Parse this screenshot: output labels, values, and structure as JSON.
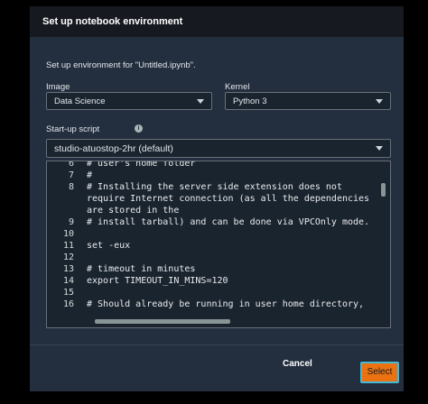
{
  "dialog": {
    "title": "Set up notebook environment",
    "subtitle": "Set up environment for \"Untitled.ipynb\".",
    "image": {
      "label": "Image",
      "value": "Data Science"
    },
    "kernel": {
      "label": "Kernel",
      "value": "Python 3"
    },
    "startup": {
      "label": "Start-up script",
      "value": "studio-atuostop-2hr (default)"
    },
    "code_lines": [
      {
        "n": "6",
        "text": "# user's home folder"
      },
      {
        "n": "7",
        "text": "#"
      },
      {
        "n": "8",
        "text": "# Installing the server side extension does not"
      },
      {
        "n": "",
        "text": "require Internet connection (as all the dependencies"
      },
      {
        "n": "",
        "text": "are stored in the"
      },
      {
        "n": "9",
        "text": "# install tarball) and can be done via VPCOnly mode."
      },
      {
        "n": "10",
        "text": ""
      },
      {
        "n": "11",
        "text": "set -eux"
      },
      {
        "n": "12",
        "text": ""
      },
      {
        "n": "13",
        "text": "# timeout in minutes"
      },
      {
        "n": "14",
        "text": "export TIMEOUT_IN_MINS=120"
      },
      {
        "n": "15",
        "text": ""
      },
      {
        "n": "16",
        "text": "# Should already be running in user home directory,"
      }
    ],
    "buttons": {
      "cancel": "Cancel",
      "select": "Select"
    }
  },
  "colors": {
    "accent": "#ec7211",
    "focus_ring": "#44b9d6",
    "dialog_bg": "#232f3e"
  },
  "icons": {
    "info": "info-icon",
    "dropdown": "caret-down-icon"
  }
}
